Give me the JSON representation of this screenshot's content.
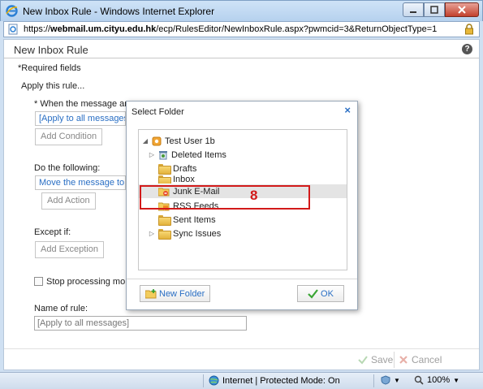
{
  "window": {
    "title": "New Inbox Rule - Windows Internet Explorer",
    "url_prefix": "https://",
    "url_host": "webmail.um.cityu.edu.hk",
    "url_path": "/ecp/RulesEditor/NewInboxRule.aspx?pwmcid=3&ReturnObjectType=1"
  },
  "page": {
    "title": "New Inbox Rule",
    "required_note": "*Required fields",
    "apply_rule": "Apply this rule...",
    "when_label": "* When the message arr",
    "when_value": "[Apply to all messages]",
    "add_condition": "Add Condition",
    "do_label": "Do the following:",
    "do_value": "Move the message to",
    "add_action": "Add Action",
    "except_label": "Except if:",
    "add_exception": "Add Exception",
    "stop_processing": "Stop processing mor",
    "name_label": "Name of rule:",
    "name_value": "[Apply to all messages]",
    "save": "Save",
    "cancel": "Cancel"
  },
  "dialog": {
    "title": "Select Folder",
    "close": "×",
    "folders": [
      {
        "label": "Test User 1b",
        "icon": "mailbox-icon"
      },
      {
        "label": "Deleted Items",
        "icon": "deleted-items-icon"
      },
      {
        "label": "Drafts",
        "icon": "drafts-icon"
      },
      {
        "label": "Inbox",
        "icon": "inbox-icon"
      },
      {
        "label": "Junk E-Mail",
        "icon": "junk-email-icon"
      },
      {
        "label": "RSS Feeds",
        "icon": "rss-icon"
      },
      {
        "label": "Sent Items",
        "icon": "sent-items-icon"
      },
      {
        "label": "Sync Issues",
        "icon": "folder-icon"
      }
    ],
    "selected": "Junk E-Mail",
    "new_folder": "New Folder",
    "ok": "OK"
  },
  "annotation": {
    "number": "8",
    "color": "#d21a1a"
  },
  "statusbar": {
    "zone": "Internet | Protected Mode: On",
    "zoom": "100%"
  },
  "colors": {
    "link": "#2a6fc4",
    "ok_check": "#3aa534",
    "cancel_x": "#d04a3a"
  }
}
